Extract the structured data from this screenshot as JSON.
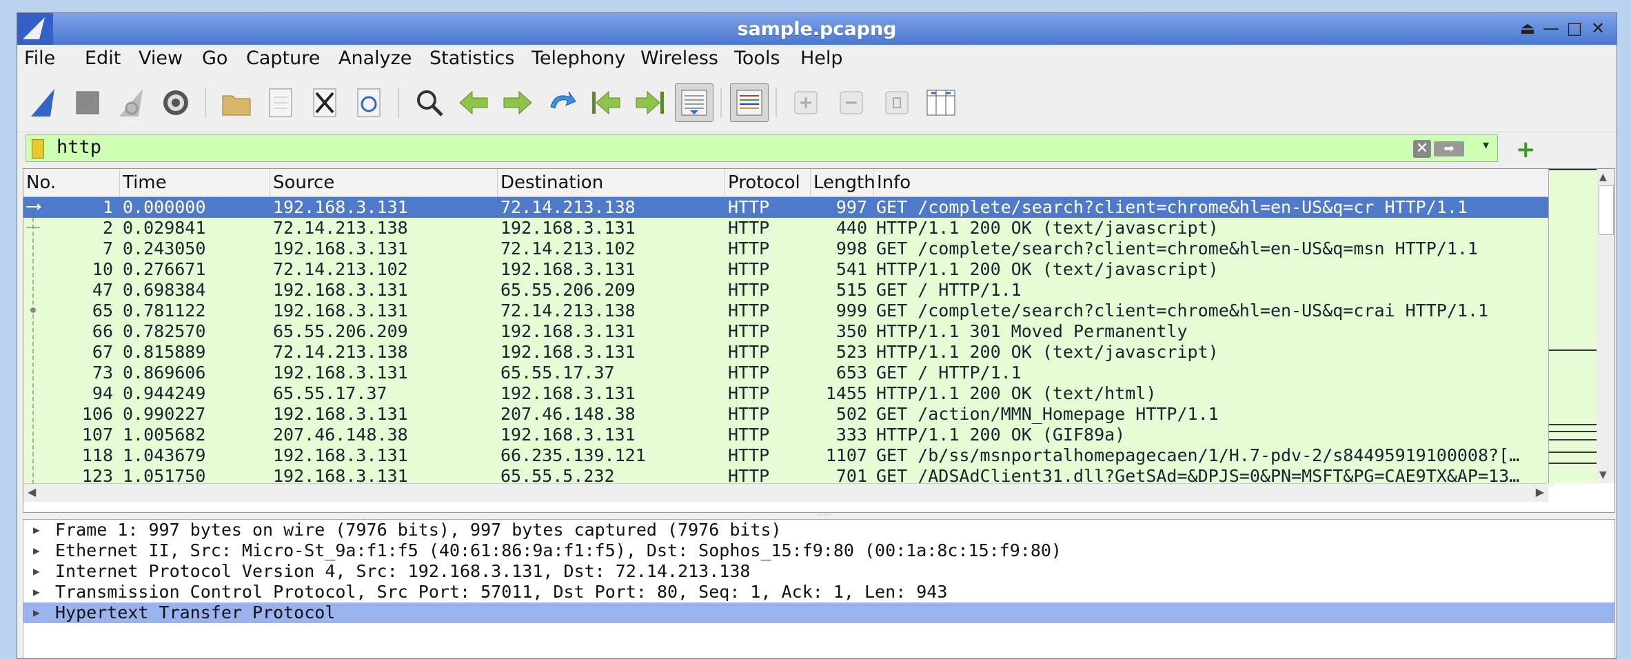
{
  "window": {
    "title": "sample.pcapng",
    "controls": [
      "⏏",
      "—",
      "□",
      "✕"
    ]
  },
  "menu": [
    "File",
    "Edit",
    "View",
    "Go",
    "Capture",
    "Analyze",
    "Statistics",
    "Telephony",
    "Wireless",
    "Tools",
    "Help"
  ],
  "toolbar": {
    "buttons": [
      {
        "name": "start-capture-icon"
      },
      {
        "name": "stop-capture-icon"
      },
      {
        "name": "restart-capture-icon"
      },
      {
        "name": "capture-options-icon"
      },
      {
        "name": "open-file-icon"
      },
      {
        "name": "save-file-icon"
      },
      {
        "name": "close-file-icon"
      },
      {
        "name": "reload-file-icon"
      },
      {
        "name": "find-packet-icon"
      },
      {
        "name": "go-back-icon"
      },
      {
        "name": "go-forward-icon"
      },
      {
        "name": "go-to-packet-icon"
      },
      {
        "name": "first-packet-icon"
      },
      {
        "name": "last-packet-icon"
      },
      {
        "name": "autoscroll-icon"
      },
      {
        "name": "colorize-icon"
      },
      {
        "name": "zoom-in-icon"
      },
      {
        "name": "zoom-out-icon"
      },
      {
        "name": "normal-size-icon"
      },
      {
        "name": "resize-columns-icon"
      }
    ]
  },
  "filter": {
    "value": "http",
    "accent": "#cfffb4"
  },
  "columns": [
    "No.",
    "Time",
    "Source",
    "Destination",
    "Protocol",
    "Length",
    "Info"
  ],
  "packets": [
    {
      "no": "1",
      "time": "0.000000",
      "src": "192.168.3.131",
      "dst": "72.14.213.138",
      "proto": "HTTP",
      "len": "997",
      "info": "GET /complete/search?client=chrome&hl=en-US&q=cr HTTP/1.1"
    },
    {
      "no": "2",
      "time": "0.029841",
      "src": "72.14.213.138",
      "dst": "192.168.3.131",
      "proto": "HTTP",
      "len": "440",
      "info": "HTTP/1.1 200 OK  (text/javascript)"
    },
    {
      "no": "7",
      "time": "0.243050",
      "src": "192.168.3.131",
      "dst": "72.14.213.102",
      "proto": "HTTP",
      "len": "998",
      "info": "GET /complete/search?client=chrome&hl=en-US&q=msn HTTP/1.1"
    },
    {
      "no": "10",
      "time": "0.276671",
      "src": "72.14.213.102",
      "dst": "192.168.3.131",
      "proto": "HTTP",
      "len": "541",
      "info": "HTTP/1.1 200 OK  (text/javascript)"
    },
    {
      "no": "47",
      "time": "0.698384",
      "src": "192.168.3.131",
      "dst": "65.55.206.209",
      "proto": "HTTP",
      "len": "515",
      "info": "GET / HTTP/1.1"
    },
    {
      "no": "65",
      "time": "0.781122",
      "src": "192.168.3.131",
      "dst": "72.14.213.138",
      "proto": "HTTP",
      "len": "999",
      "info": "GET /complete/search?client=chrome&hl=en-US&q=crai HTTP/1.1"
    },
    {
      "no": "66",
      "time": "0.782570",
      "src": "65.55.206.209",
      "dst": "192.168.3.131",
      "proto": "HTTP",
      "len": "350",
      "info": "HTTP/1.1 301 Moved Permanently"
    },
    {
      "no": "67",
      "time": "0.815889",
      "src": "72.14.213.138",
      "dst": "192.168.3.131",
      "proto": "HTTP",
      "len": "523",
      "info": "HTTP/1.1 200 OK  (text/javascript)"
    },
    {
      "no": "73",
      "time": "0.869606",
      "src": "192.168.3.131",
      "dst": "65.55.17.37",
      "proto": "HTTP",
      "len": "653",
      "info": "GET / HTTP/1.1"
    },
    {
      "no": "94",
      "time": "0.944249",
      "src": "65.55.17.37",
      "dst": "192.168.3.131",
      "proto": "HTTP",
      "len": "1455",
      "info": "HTTP/1.1 200 OK  (text/html)"
    },
    {
      "no": "106",
      "time": "0.990227",
      "src": "192.168.3.131",
      "dst": "207.46.148.38",
      "proto": "HTTP",
      "len": "502",
      "info": "GET /action/MMN_Homepage HTTP/1.1"
    },
    {
      "no": "107",
      "time": "1.005682",
      "src": "207.46.148.38",
      "dst": "192.168.3.131",
      "proto": "HTTP",
      "len": "333",
      "info": "HTTP/1.1 200 OK  (GIF89a)"
    },
    {
      "no": "118",
      "time": "1.043679",
      "src": "192.168.3.131",
      "dst": "66.235.139.121",
      "proto": "HTTP",
      "len": "1107",
      "info": "GET /b/ss/msnportalhomepagecaen/1/H.7-pdv-2/s84495919100008?[…"
    },
    {
      "no": "123",
      "time": "1.051750",
      "src": "192.168.3.131",
      "dst": "65.55.5.232",
      "proto": "HTTP",
      "len": "701",
      "info": "GET /ADSAdClient31.dll?GetSAd=&DPJS=0&PN=MSFT&PG=CAE9TX&AP=13…"
    }
  ],
  "selected_packet_index": 0,
  "details": [
    "Frame 1: 997 bytes on wire (7976 bits), 997 bytes captured (7976 bits)",
    "Ethernet II, Src: Micro-St_9a:f1:f5 (40:61:86:9a:f1:f5), Dst: Sophos_15:f9:80 (00:1a:8c:15:f9:80)",
    "Internet Protocol Version 4, Src: 192.168.3.131, Dst: 72.14.213.138",
    "Transmission Control Protocol, Src Port: 57011, Dst Port: 80, Seq: 1, Ack: 1, Len: 943",
    "Hypertext Transfer Protocol"
  ],
  "selected_detail_index": 4,
  "colors": {
    "title_bar": "#4a78d2",
    "selected_row": "#4e7ac9",
    "http_row": "#e7fbd4",
    "selected_detail": "#9ab3ef"
  }
}
